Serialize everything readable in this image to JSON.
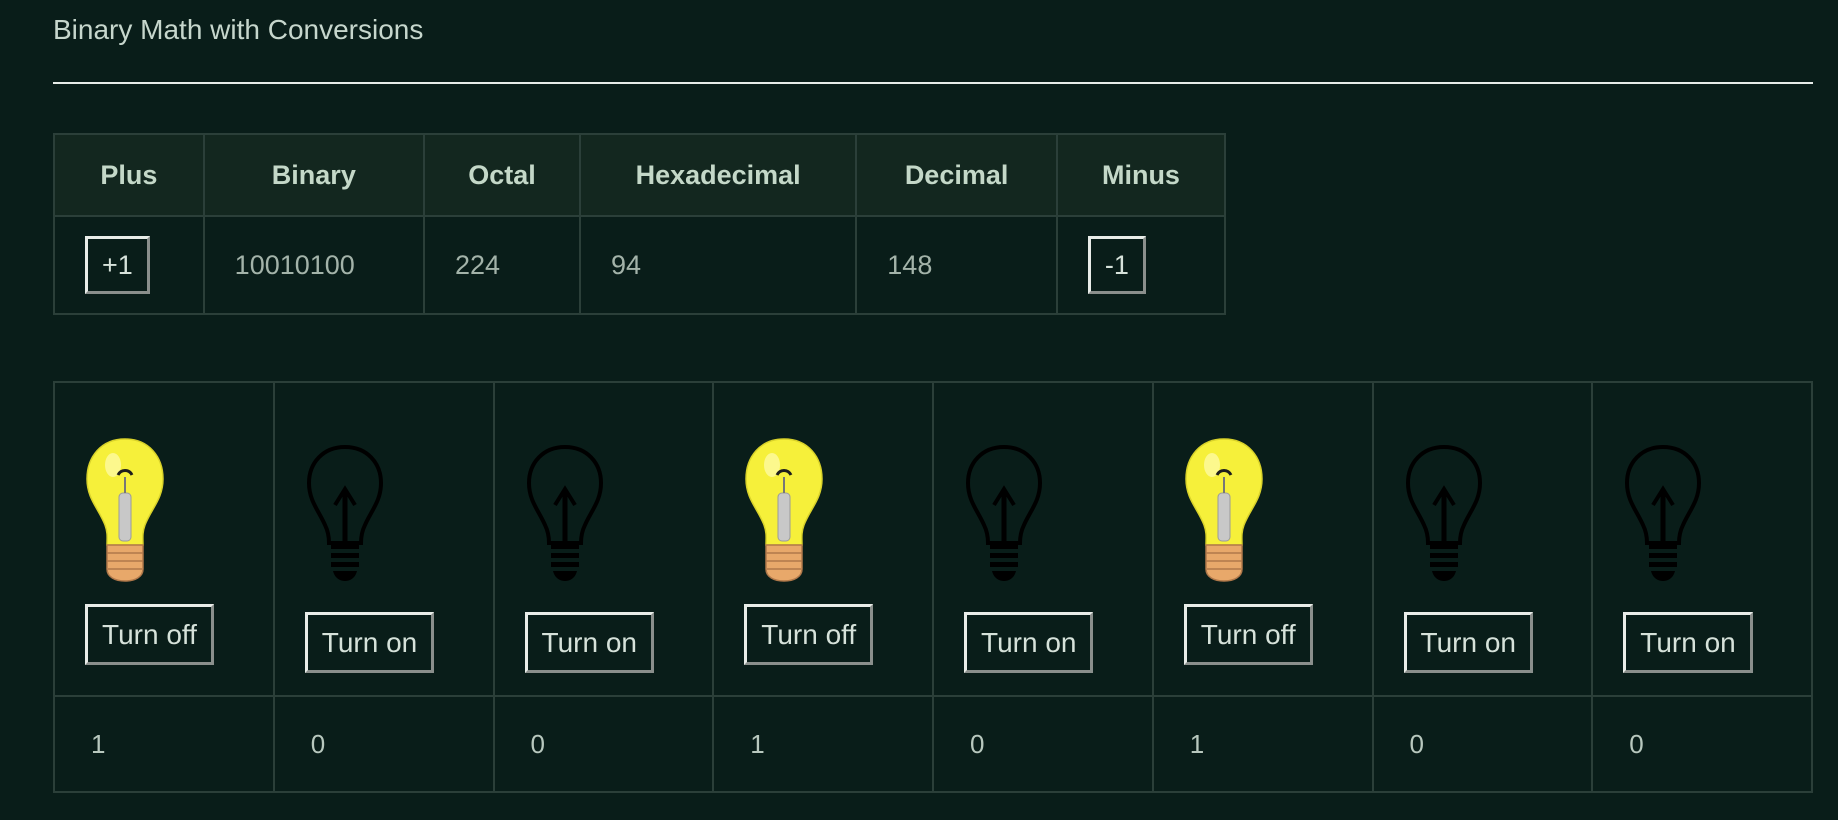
{
  "page": {
    "title": "Binary Math with Conversions"
  },
  "conversion": {
    "headers": {
      "plus": "Plus",
      "binary": "Binary",
      "octal": "Octal",
      "hexadecimal": "Hexadecimal",
      "decimal": "Decimal",
      "minus": "Minus"
    },
    "plus_button": "+1",
    "minus_button": "-1",
    "binary": "10010100",
    "octal": "224",
    "hexadecimal": "94",
    "decimal": "148"
  },
  "bulbs": [
    {
      "state": "on",
      "bulb_icon": "lit-bulb-icon",
      "button": "Turn off",
      "bit": "1"
    },
    {
      "state": "off",
      "bulb_icon": "unlit-bulb-icon",
      "button": "Turn on",
      "bit": "0"
    },
    {
      "state": "off",
      "bulb_icon": "unlit-bulb-icon",
      "button": "Turn on",
      "bit": "0"
    },
    {
      "state": "on",
      "bulb_icon": "lit-bulb-icon",
      "button": "Turn off",
      "bit": "1"
    },
    {
      "state": "off",
      "bulb_icon": "unlit-bulb-icon",
      "button": "Turn on",
      "bit": "0"
    },
    {
      "state": "on",
      "bulb_icon": "lit-bulb-icon",
      "button": "Turn off",
      "bit": "1"
    },
    {
      "state": "off",
      "bulb_icon": "unlit-bulb-icon",
      "button": "Turn on",
      "bit": "0"
    },
    {
      "state": "off",
      "bulb_icon": "unlit-bulb-icon",
      "button": "Turn on",
      "bit": "0"
    }
  ],
  "colors": {
    "background": "#091d19",
    "bulb_on": "#f6f03a",
    "bulb_base": "#e8a86a"
  }
}
